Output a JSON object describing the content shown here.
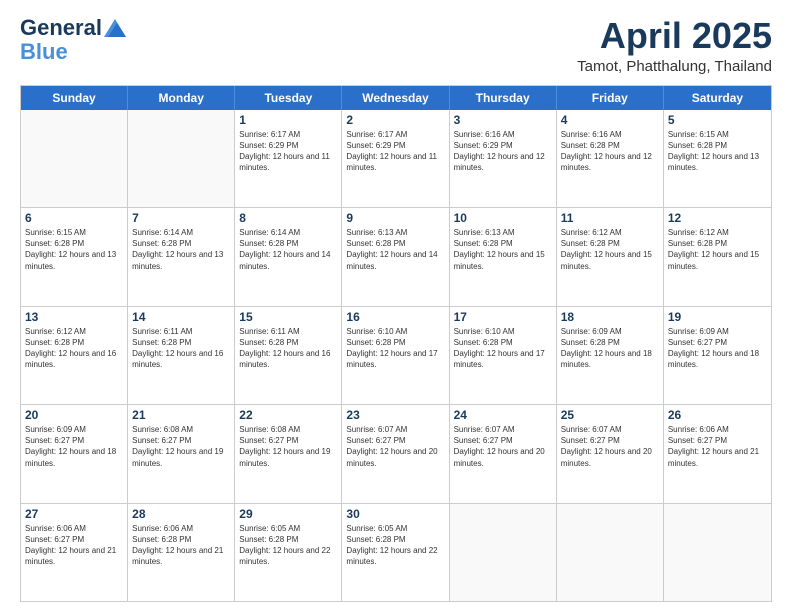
{
  "logo": {
    "line1": "General",
    "line2": "Blue"
  },
  "title": "April 2025",
  "subtitle": "Tamot, Phatthalung, Thailand",
  "days": [
    "Sunday",
    "Monday",
    "Tuesday",
    "Wednesday",
    "Thursday",
    "Friday",
    "Saturday"
  ],
  "weeks": [
    [
      {
        "day": "",
        "info": ""
      },
      {
        "day": "",
        "info": ""
      },
      {
        "day": "1",
        "info": "Sunrise: 6:17 AM\nSunset: 6:29 PM\nDaylight: 12 hours and 11 minutes."
      },
      {
        "day": "2",
        "info": "Sunrise: 6:17 AM\nSunset: 6:29 PM\nDaylight: 12 hours and 11 minutes."
      },
      {
        "day": "3",
        "info": "Sunrise: 6:16 AM\nSunset: 6:29 PM\nDaylight: 12 hours and 12 minutes."
      },
      {
        "day": "4",
        "info": "Sunrise: 6:16 AM\nSunset: 6:28 PM\nDaylight: 12 hours and 12 minutes."
      },
      {
        "day": "5",
        "info": "Sunrise: 6:15 AM\nSunset: 6:28 PM\nDaylight: 12 hours and 13 minutes."
      }
    ],
    [
      {
        "day": "6",
        "info": "Sunrise: 6:15 AM\nSunset: 6:28 PM\nDaylight: 12 hours and 13 minutes."
      },
      {
        "day": "7",
        "info": "Sunrise: 6:14 AM\nSunset: 6:28 PM\nDaylight: 12 hours and 13 minutes."
      },
      {
        "day": "8",
        "info": "Sunrise: 6:14 AM\nSunset: 6:28 PM\nDaylight: 12 hours and 14 minutes."
      },
      {
        "day": "9",
        "info": "Sunrise: 6:13 AM\nSunset: 6:28 PM\nDaylight: 12 hours and 14 minutes."
      },
      {
        "day": "10",
        "info": "Sunrise: 6:13 AM\nSunset: 6:28 PM\nDaylight: 12 hours and 15 minutes."
      },
      {
        "day": "11",
        "info": "Sunrise: 6:12 AM\nSunset: 6:28 PM\nDaylight: 12 hours and 15 minutes."
      },
      {
        "day": "12",
        "info": "Sunrise: 6:12 AM\nSunset: 6:28 PM\nDaylight: 12 hours and 15 minutes."
      }
    ],
    [
      {
        "day": "13",
        "info": "Sunrise: 6:12 AM\nSunset: 6:28 PM\nDaylight: 12 hours and 16 minutes."
      },
      {
        "day": "14",
        "info": "Sunrise: 6:11 AM\nSunset: 6:28 PM\nDaylight: 12 hours and 16 minutes."
      },
      {
        "day": "15",
        "info": "Sunrise: 6:11 AM\nSunset: 6:28 PM\nDaylight: 12 hours and 16 minutes."
      },
      {
        "day": "16",
        "info": "Sunrise: 6:10 AM\nSunset: 6:28 PM\nDaylight: 12 hours and 17 minutes."
      },
      {
        "day": "17",
        "info": "Sunrise: 6:10 AM\nSunset: 6:28 PM\nDaylight: 12 hours and 17 minutes."
      },
      {
        "day": "18",
        "info": "Sunrise: 6:09 AM\nSunset: 6:28 PM\nDaylight: 12 hours and 18 minutes."
      },
      {
        "day": "19",
        "info": "Sunrise: 6:09 AM\nSunset: 6:27 PM\nDaylight: 12 hours and 18 minutes."
      }
    ],
    [
      {
        "day": "20",
        "info": "Sunrise: 6:09 AM\nSunset: 6:27 PM\nDaylight: 12 hours and 18 minutes."
      },
      {
        "day": "21",
        "info": "Sunrise: 6:08 AM\nSunset: 6:27 PM\nDaylight: 12 hours and 19 minutes."
      },
      {
        "day": "22",
        "info": "Sunrise: 6:08 AM\nSunset: 6:27 PM\nDaylight: 12 hours and 19 minutes."
      },
      {
        "day": "23",
        "info": "Sunrise: 6:07 AM\nSunset: 6:27 PM\nDaylight: 12 hours and 20 minutes."
      },
      {
        "day": "24",
        "info": "Sunrise: 6:07 AM\nSunset: 6:27 PM\nDaylight: 12 hours and 20 minutes."
      },
      {
        "day": "25",
        "info": "Sunrise: 6:07 AM\nSunset: 6:27 PM\nDaylight: 12 hours and 20 minutes."
      },
      {
        "day": "26",
        "info": "Sunrise: 6:06 AM\nSunset: 6:27 PM\nDaylight: 12 hours and 21 minutes."
      }
    ],
    [
      {
        "day": "27",
        "info": "Sunrise: 6:06 AM\nSunset: 6:27 PM\nDaylight: 12 hours and 21 minutes."
      },
      {
        "day": "28",
        "info": "Sunrise: 6:06 AM\nSunset: 6:28 PM\nDaylight: 12 hours and 21 minutes."
      },
      {
        "day": "29",
        "info": "Sunrise: 6:05 AM\nSunset: 6:28 PM\nDaylight: 12 hours and 22 minutes."
      },
      {
        "day": "30",
        "info": "Sunrise: 6:05 AM\nSunset: 6:28 PM\nDaylight: 12 hours and 22 minutes."
      },
      {
        "day": "",
        "info": ""
      },
      {
        "day": "",
        "info": ""
      },
      {
        "day": "",
        "info": ""
      }
    ]
  ]
}
